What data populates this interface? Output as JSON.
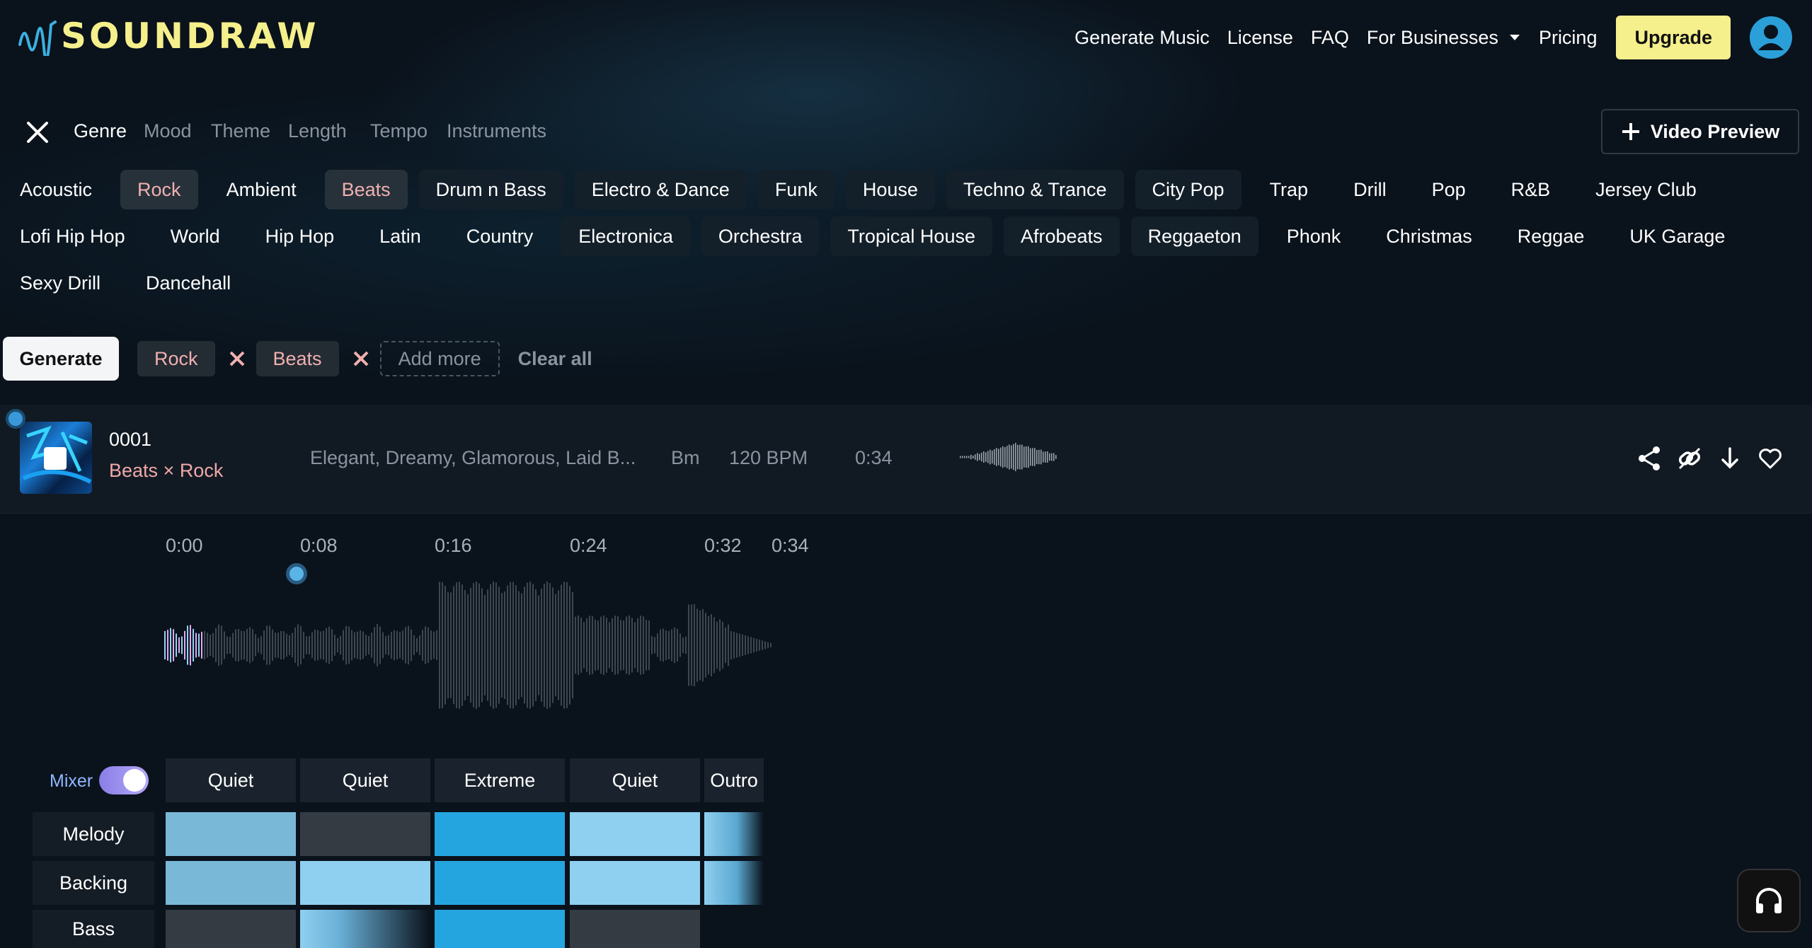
{
  "brand": {
    "name": "SOUNDRAW",
    "logo_color": "#f5ef8c"
  },
  "nav": {
    "links": [
      "Generate Music",
      "License",
      "FAQ"
    ],
    "businesses": "For Businesses",
    "pricing": "Pricing",
    "upgrade": "Upgrade"
  },
  "filters": {
    "tabs": [
      "Genre",
      "Mood",
      "Theme",
      "Length",
      "Tempo",
      "Instruments"
    ],
    "active_tab": "Genre",
    "video_preview": "Video Preview"
  },
  "genres": [
    {
      "label": "Acoustic",
      "selected": false
    },
    {
      "label": "Rock",
      "selected": true
    },
    {
      "label": "Ambient",
      "selected": false
    },
    {
      "label": "Beats",
      "selected": true
    },
    {
      "label": "Drum n Bass",
      "selected": false
    },
    {
      "label": "Electro & Dance",
      "selected": false
    },
    {
      "label": "Funk",
      "selected": false
    },
    {
      "label": "House",
      "selected": false
    },
    {
      "label": "Techno & Trance",
      "selected": false
    },
    {
      "label": "City Pop",
      "selected": false
    },
    {
      "label": "Trap",
      "selected": false
    },
    {
      "label": "Drill",
      "selected": false
    },
    {
      "label": "Pop",
      "selected": false
    },
    {
      "label": "R&B",
      "selected": false
    },
    {
      "label": "Jersey Club",
      "selected": false
    },
    {
      "label": "Lofi Hip Hop",
      "selected": false
    },
    {
      "label": "World",
      "selected": false
    },
    {
      "label": "Hip Hop",
      "selected": false
    },
    {
      "label": "Latin",
      "selected": false
    },
    {
      "label": "Country",
      "selected": false
    },
    {
      "label": "Electronica",
      "selected": false
    },
    {
      "label": "Orchestra",
      "selected": false
    },
    {
      "label": "Tropical House",
      "selected": false
    },
    {
      "label": "Afrobeats",
      "selected": false
    },
    {
      "label": "Reggaeton",
      "selected": false
    },
    {
      "label": "Phonk",
      "selected": false
    },
    {
      "label": "Christmas",
      "selected": false
    },
    {
      "label": "Reggae",
      "selected": false
    },
    {
      "label": "UK Garage",
      "selected": false
    },
    {
      "label": "Sexy Drill",
      "selected": false
    },
    {
      "label": "Dancehall",
      "selected": false
    }
  ],
  "actions": {
    "generate": "Generate",
    "tags": [
      "Rock",
      "Beats"
    ],
    "add_more": "Add more",
    "clear_all": "Clear all"
  },
  "track": {
    "number": "0001",
    "genre": "Beats × Rock",
    "moods": "Elegant, Dreamy, Glamorous, Laid B...",
    "key": "Bm",
    "bpm": "120 BPM",
    "length": "0:34",
    "icons": [
      "share-icon",
      "unlink-icon",
      "download-icon",
      "heart-icon"
    ]
  },
  "timeline": {
    "marks": [
      "0:00",
      "0:08",
      "0:16",
      "0:24",
      "0:32",
      "0:34"
    ],
    "playhead": "0:08"
  },
  "mixer": {
    "label": "Mixer",
    "enabled": true,
    "sections": [
      "Quiet",
      "Quiet",
      "Extreme",
      "Quiet",
      "Outro"
    ],
    "rows": [
      {
        "label": "Melody",
        "levels": [
          1,
          0,
          3,
          2,
          2
        ]
      },
      {
        "label": "Backing",
        "levels": [
          1,
          2,
          3,
          2,
          2
        ]
      },
      {
        "label": "Bass",
        "levels": [
          0,
          2,
          3,
          0
        ]
      }
    ]
  },
  "colors": {
    "accent": "#f5ef8c",
    "selected_text": "#f0b0b0",
    "mixer_high": "#25a5e0"
  }
}
